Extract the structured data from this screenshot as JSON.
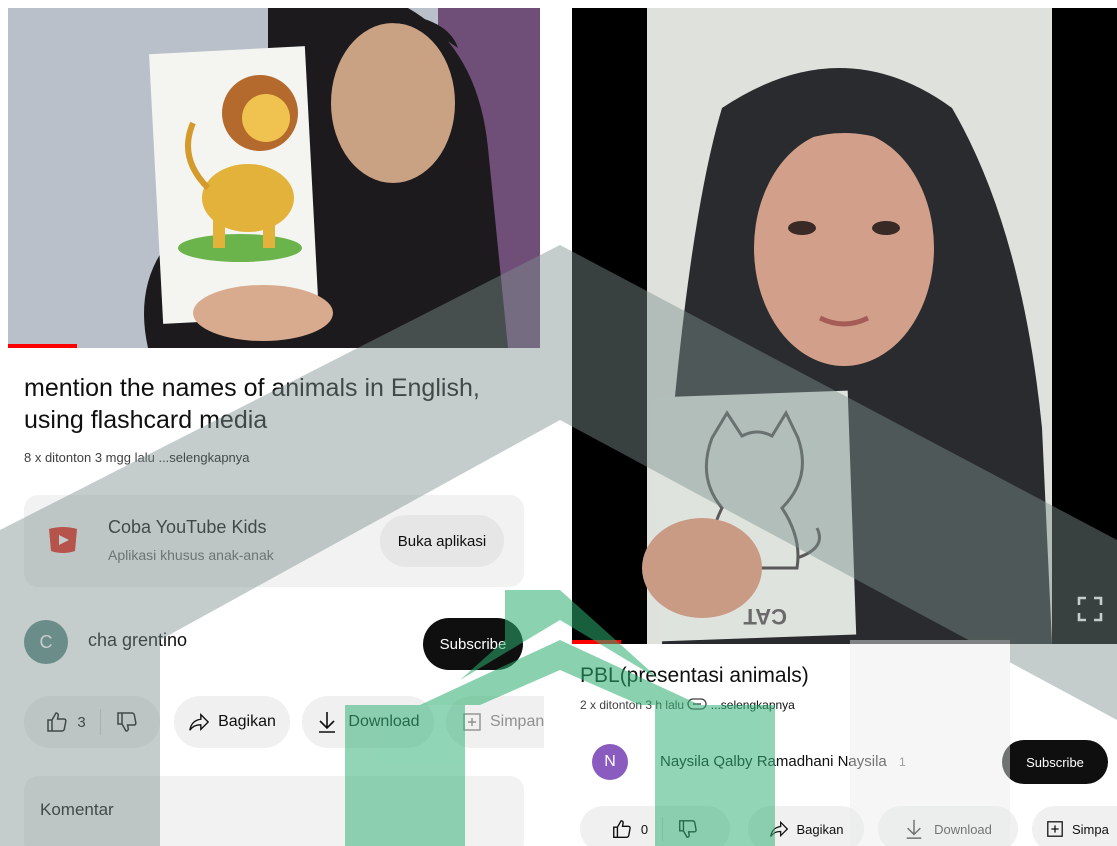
{
  "left": {
    "video": {
      "progress_fraction": 0.13
    },
    "title": "mention the names of animals in English, using flashcard media",
    "meta": {
      "views": "8 x ditonton",
      "age": "3 mgg lalu",
      "more": "...selengkapnya"
    },
    "promo": {
      "title": "Coba YouTube Kids",
      "subtitle": "Aplikasi khusus anak-anak",
      "button": "Buka aplikasi",
      "icon": "youtube-kids-icon"
    },
    "channel": {
      "avatar_letter": "C",
      "name": "cha grentino",
      "subscribe": "Subscribe"
    },
    "actions": {
      "likes": "3",
      "share": "Bagikan",
      "download": "Download",
      "save": "Simpan"
    },
    "comments": {
      "label": "Komentar"
    }
  },
  "right": {
    "video": {
      "progress_fraction": 0.09
    },
    "title": "PBL(presentasi animals)",
    "meta": {
      "views": "2 x ditonton",
      "age": "3 h lalu",
      "more": "...selengkapnya"
    },
    "channel": {
      "avatar_letter": "N",
      "name": "Naysila Qalby Ramadhani Naysila",
      "subscribers": "1",
      "subscribe": "Subscribe"
    },
    "actions": {
      "likes": "0",
      "share": "Bagikan",
      "download": "Download",
      "save": "Simpa"
    },
    "card_caption": "CAT"
  },
  "colors": {
    "youtube_red": "#ff0000",
    "chip_bg": "#f0f0f0",
    "watermark_gray": "#6f8580",
    "watermark_green": "#25a86e"
  }
}
